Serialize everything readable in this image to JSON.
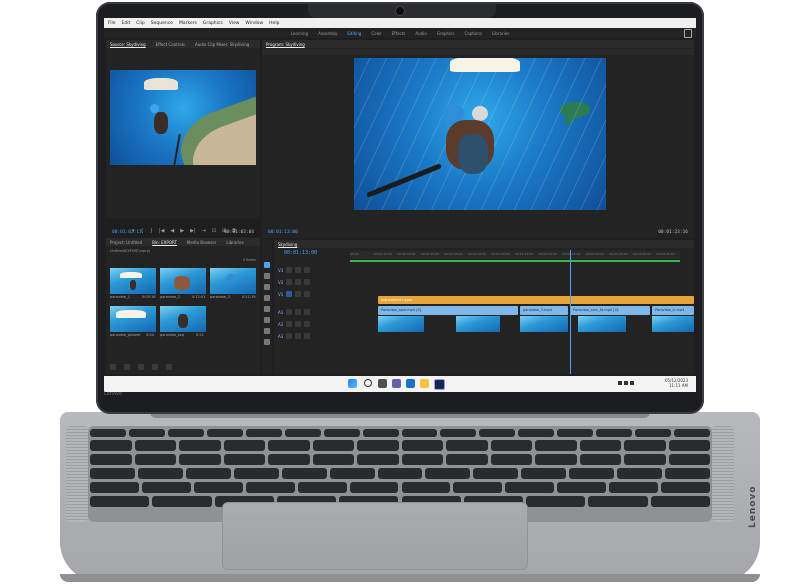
{
  "menubar": [
    "File",
    "Edit",
    "Clip",
    "Sequence",
    "Markers",
    "Graphics",
    "View",
    "Window",
    "Help"
  ],
  "workspaces": [
    {
      "label": "Learning",
      "active": false
    },
    {
      "label": "Assembly",
      "active": false
    },
    {
      "label": "Editing",
      "active": true
    },
    {
      "label": "Color",
      "active": false
    },
    {
      "label": "Effects",
      "active": false
    },
    {
      "label": "Audio",
      "active": false
    },
    {
      "label": "Graphics",
      "active": false
    },
    {
      "label": "Captions",
      "active": false
    },
    {
      "label": "Libraries",
      "active": false
    }
  ],
  "source": {
    "tabs": [
      "Source: Skydiving",
      "Effect Controls",
      "Audio Clip Mixer: Skydiving"
    ],
    "timecode_left": "00:01:02:11",
    "timecode_right": "00:01:03:04"
  },
  "program": {
    "tab": "Program: Skydiving",
    "timecode_left": "00:01:13:00",
    "timecode_right": "00:01:23:16"
  },
  "project": {
    "tabs": [
      "Project: Untitled",
      "Bin: EXPORT",
      "Media Browser",
      "Libraries"
    ],
    "path": "Untitled/EXPORT.prproj",
    "count": "5 Items",
    "clips": [
      {
        "name": "paraview_1",
        "dur": "0:05:16"
      },
      {
        "name": "paraview_2",
        "dur": "0:12:02"
      },
      {
        "name": "paraview_3",
        "dur": "0:11:19"
      },
      {
        "name": "paraview_plsheet",
        "dur": "0:04"
      },
      {
        "name": "paraview_seq",
        "dur": "0:21"
      }
    ]
  },
  "timeline": {
    "tab": "Skydiving",
    "timecode": "00:01:13:00",
    "ruler": [
      "00:00",
      "00:00:15:00",
      "00:00:30:00",
      "00:00:45:00",
      "00:01:00:00",
      "00:01:15:00",
      "00:01:30:00",
      "00:01:45:00",
      "00:02:00:00",
      "00:02:15:00",
      "00:02:30:00",
      "00:02:45:00",
      "00:03:00:00",
      "00:03:15:00"
    ],
    "tracks": [
      "V3",
      "V2",
      "V1",
      "A1",
      "A2",
      "A3"
    ],
    "clip_adjust": "Adjustment Layer",
    "clips": [
      "Paraview_oper.mp4 [V]",
      "paraview_3.mp4",
      "Paraview_cam_fd.mp4 [V]",
      "Paraview_lc.mp4"
    ]
  },
  "taskbar": {
    "time": "11:11 AM",
    "date": "05/12/2023"
  },
  "brand": "Lenovo",
  "colors": {
    "accent": "#4aa3ff",
    "adjust": "#e7a43a",
    "clip": "#7fb7e8"
  }
}
